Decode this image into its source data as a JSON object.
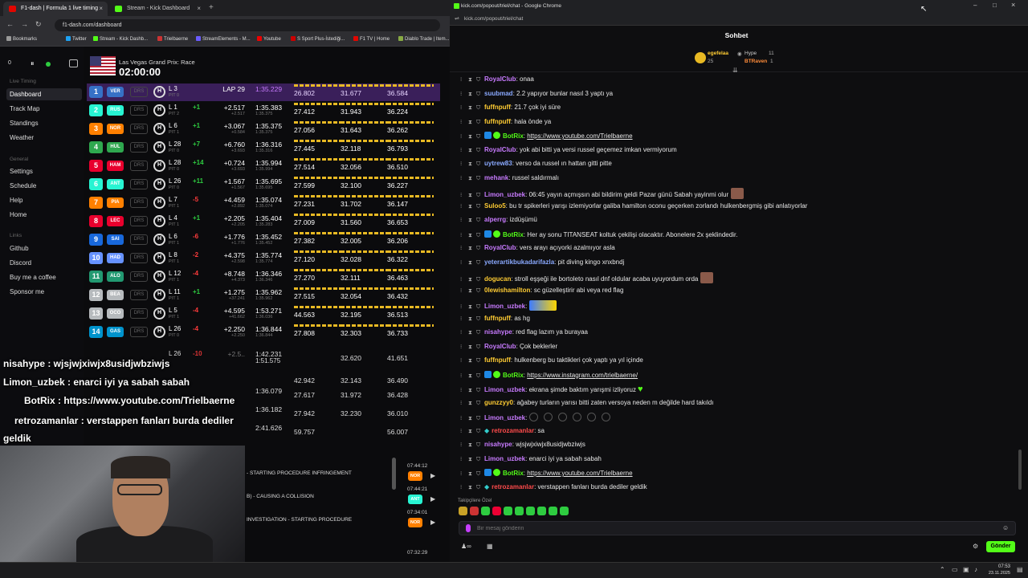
{
  "left_browser": {
    "tabs": [
      {
        "label": "F1-dash | Formula 1 live timing"
      },
      {
        "label": "Stream - Kick Dashboard"
      }
    ],
    "new_tab": "+",
    "url": "f1-dash.com/dashboard",
    "bookmarks": [
      "Bookmarks",
      "Twitter",
      "Stream - Kick Dashb...",
      "Trielbaerne",
      "StreamElements - M...",
      "Youtube",
      "S Sport Plus-İstediği...",
      "F1 TV | Home",
      "Diablo Trade | Item..."
    ]
  },
  "dashboard": {
    "race_name": "Las Vegas Grand Prix: Race",
    "clock": "02:00:00",
    "controls": {
      "count": "0",
      "pause": "⏸"
    },
    "sidebar": {
      "live_timing_header": "Live Timing",
      "live_items": [
        "Dashboard",
        "Track Map",
        "Standings",
        "Weather"
      ],
      "general_header": "General",
      "general_items": [
        "Settings",
        "Schedule",
        "Help",
        "Home"
      ],
      "links_header": "Links",
      "links_items": [
        "Github",
        "Discord",
        "Buy me a coffee",
        "Sponsor me"
      ]
    },
    "drs_label": "DRS",
    "rows": [
      {
        "pos": "1",
        "team": "VER",
        "color": "#3671C6",
        "tyre": "H",
        "lap": "L 3",
        "pit": "PIT 0",
        "pm": "",
        "gap": "LAP 29",
        "gap2": "",
        "lt": "1:35.229",
        "lt2": "",
        "s1": "26.802",
        "s2": "31.677",
        "s3": "36.584",
        "hl": true
      },
      {
        "pos": "2",
        "team": "RUS",
        "color": "#27F4D2",
        "tyre": "H",
        "lap": "L 1",
        "pit": "PIT 2",
        "pm": "+1",
        "gap": "+2.517",
        "gap2": "+2.517",
        "lt": "1:35.383",
        "lt2": "1:35.375",
        "s1": "27.412",
        "s2": "31.943",
        "s3": "36.224"
      },
      {
        "pos": "3",
        "team": "NOR",
        "color": "#FF8000",
        "tyre": "H",
        "lap": "L 6",
        "pit": "PIT 1",
        "pm": "+1",
        "gap": "+3.067",
        "gap2": "+0.584",
        "lt": "1:35.375",
        "lt2": "1:35.375",
        "s1": "27.056",
        "s2": "31.643",
        "s3": "36.262"
      },
      {
        "pos": "4",
        "team": "HUL",
        "color": "#2fa84f",
        "tyre": "H",
        "lap": "L 28",
        "pit": "PIT 0",
        "pm": "+7",
        "gap": "+6.760",
        "gap2": "+3.693",
        "lt": "1:36.316",
        "lt2": "1:35.316",
        "s1": "27.445",
        "s2": "32.118",
        "s3": "36.793"
      },
      {
        "pos": "5",
        "team": "HAM",
        "color": "#E8002D",
        "tyre": "H",
        "lap": "L 28",
        "pit": "PIT 0",
        "pm": "+14",
        "gap": "+0.724",
        "gap2": "+3.693",
        "lt": "1:35.994",
        "lt2": "1:35.994",
        "s1": "27.514",
        "s2": "32.056",
        "s3": "36.510"
      },
      {
        "pos": "6",
        "team": "ANT",
        "color": "#27F4D2",
        "tyre": "H",
        "lap": "L 26",
        "pit": "PIT 0",
        "pm": "+11",
        "gap": "+1.567",
        "gap2": "+1.567",
        "lt": "1:35.695",
        "lt2": "1:35.695",
        "s1": "27.599",
        "s2": "32.100",
        "s3": "36.227"
      },
      {
        "pos": "7",
        "team": "PIA",
        "color": "#FF8000",
        "tyre": "H",
        "lap": "L 7",
        "pit": "PIT 1",
        "pm": "-5",
        "gap": "+4.459",
        "gap2": "+2.892",
        "lt": "1:35.074",
        "lt2": "1:35.074",
        "s1": "27.231",
        "s2": "31.702",
        "s3": "36.147"
      },
      {
        "pos": "8",
        "team": "LEC",
        "color": "#E8002D",
        "tyre": "H",
        "lap": "L 4",
        "pit": "PIT 1",
        "pm": "+1",
        "gap": "+2.205",
        "gap2": "+2.205",
        "lt": "1:35.404",
        "lt2": "1:35.283",
        "s1": "27.009",
        "s2": "31.560",
        "s3": "36.653"
      },
      {
        "pos": "9",
        "team": "SAI",
        "color": "#1868DB",
        "tyre": "H",
        "lap": "L 6",
        "pit": "PIT 1",
        "pm": "-6",
        "gap": "+1.776",
        "gap2": "+1.776",
        "lt": "1:35.452",
        "lt2": "1:35.452",
        "s1": "27.382",
        "s2": "32.005",
        "s3": "36.206"
      },
      {
        "pos": "10",
        "team": "HAD",
        "color": "#6692FF",
        "tyre": "H",
        "lap": "L 8",
        "pit": "PIT 1",
        "pm": "-2",
        "gap": "+4.375",
        "gap2": "+2.598",
        "lt": "1:35.774",
        "lt2": "1:35.774",
        "s1": "27.120",
        "s2": "32.028",
        "s3": "36.322"
      },
      {
        "pos": "11",
        "team": "ALO",
        "color": "#229971",
        "tyre": "H",
        "lap": "L 12",
        "pit": "PIT 1",
        "pm": "-4",
        "gap": "+8.748",
        "gap2": "+4.373",
        "lt": "1:36.346",
        "lt2": "1:36.346",
        "s1": "27.270",
        "s2": "32.111",
        "s3": "36.463"
      },
      {
        "pos": "12",
        "team": "BEA",
        "color": "#B6BABD",
        "tyre": "H",
        "lap": "L 11",
        "pit": "PIT 1",
        "pm": "+1",
        "gap": "+1.275",
        "gap2": "+37.241",
        "lt": "1:35.962",
        "lt2": "1:35.962",
        "s1": "27.515",
        "s2": "32.054",
        "s3": "36.432"
      },
      {
        "pos": "13",
        "team": "OCO",
        "color": "#B6BABD",
        "tyre": "H",
        "lap": "L 5",
        "pit": "PIT 1",
        "pm": "-4",
        "gap": "+4.595",
        "gap2": "+41.662",
        "lt": "1:53.271",
        "lt2": "1:36.036",
        "s1": "44.563",
        "s2": "32.195",
        "s3": "36.513"
      },
      {
        "pos": "14",
        "team": "GAS",
        "color": "#0093CC",
        "tyre": "H",
        "lap": "L 26",
        "pit": "PIT 0",
        "pm": "-4",
        "gap": "+2.250",
        "gap2": "+2.250",
        "lt": "1:36.844",
        "lt2": "1:36.844",
        "s1": "27.808",
        "s2": "32.303",
        "s3": "36.733"
      }
    ],
    "hidden_rows": [
      {
        "lap": "L 26",
        "pm": "-10",
        "gap": "+2.5..",
        "lt": "1:42.231",
        "lt2": "1:51.575",
        "s1": "",
        "s2": "32.620",
        "s3": "41.651"
      },
      {
        "lap": "",
        "pm": "",
        "gap": "",
        "lt": "",
        "lt2": "",
        "s1": "42.942",
        "s2": "32.143",
        "s3": "36.490"
      },
      {
        "lap": "",
        "pm": "",
        "gap": "",
        "lt": "1:36.079",
        "lt2": "",
        "s1": "27.617",
        "s2": "31.972",
        "s3": "36.428"
      },
      {
        "lap": "",
        "pm": "",
        "gap": "",
        "lt": "1:36.182",
        "lt2": "",
        "s1": "27.942",
        "s2": "32.230",
        "s3": "36.010"
      },
      {
        "lap": "",
        "pm": "",
        "gap": "",
        "lt": "2:41.626",
        "lt2": "",
        "s1": "59.757",
        "s2": "",
        "s3": "56.007"
      }
    ],
    "overlay_chat": [
      {
        "text": "nisahype : wjsjwjxiwjx8usidjwbziwjs"
      },
      {
        "text": "Limon_uzbek : enarci iyi ya sabah sabah"
      },
      {
        "text": "BotRix : https://www.youtube.com/Trielbaerne"
      },
      {
        "text": "retrozamanlar : verstappen fanları burda dediler"
      },
      {
        "text": "geldik"
      }
    ],
    "race_control": [
      {
        "text": "- STARTING PROCEDURE INFRINGEMENT",
        "time": "07:44:12",
        "team": "NOR",
        "color": "#FF8000"
      },
      {
        "text": "B) - CAUSING A COLLISION",
        "time": "07:44:21",
        "team": "ANT",
        "color": "#27F4D2"
      },
      {
        "text": "INVESTIGATION - STARTING PROCEDURE",
        "time": "07:34:01",
        "team": "NOR",
        "color": "#FF8000"
      }
    ],
    "race_control_last_time": "07:32:29"
  },
  "chat_window": {
    "title": "kick.com/popout/triel/chat - Google Chrome",
    "url": "kick.com/popout/triel/chat",
    "header": "Sohbet",
    "pinned_user": "egefelaa",
    "pinned_count": "25",
    "hype_label": "Hype",
    "hype_count": "11",
    "hype_user": "BTRaven",
    "hype_user_count": "1",
    "messages": [
      {
        "user": "RoyalClub",
        "color": "#c87bff",
        "text": "onaa"
      },
      {
        "user": "suubmad",
        "color": "#8aa9ff",
        "text": "2.2 yapıyor bunlar nasıl 3 yaptı ya"
      },
      {
        "user": "fuffnpuff",
        "color": "#ffcc33",
        "text": "21.7 çok iyi süre"
      },
      {
        "user": "fuffnpuff",
        "color": "#ffcc33",
        "text": "hala önde ya"
      },
      {
        "user": "BotRix",
        "color": "#53fc18",
        "text": "https://www.youtube.com/Trielbaerne",
        "link": true
      },
      {
        "user": "RoyalClub",
        "color": "#c87bff",
        "text": "yok abi bitti ya versi russel geçemez imkan vermiyorum"
      },
      {
        "user": "uytrew83",
        "color": "#8aa9ff",
        "text": "verso da russel ın hattan gitti pitte"
      },
      {
        "user": "mehank",
        "color": "#c87bff",
        "text": "russel saldırmalı"
      },
      {
        "user": "Limon_uzbek",
        "color": "#c87bff",
        "text": "06:45 yayın açmışsın abi bildirim geldi Pazar günü Sabah yayinmi olur"
      },
      {
        "user": "Suloo5",
        "color": "#ffcc33",
        "text": "bu tr spikerleri yarışı izlemiyorlar galiba hamilton oconu geçerken zorlandı hulkenbergmiş gibi anlatıyorlar"
      },
      {
        "user": "alperrg",
        "color": "#c87bff",
        "text": "izdüşümü"
      },
      {
        "user": "BotRix",
        "color": "#53fc18",
        "text": "Her ay sonu TITANSEAT koltuk çekilişi olacaktır. Abonelere 2x şeklindedir."
      },
      {
        "user": "RoyalClub",
        "color": "#c87bff",
        "text": "vers arayı açıyorki azalmıyor asla"
      },
      {
        "user": "yeterartikbukadarifazla",
        "color": "#8aa9ff",
        "text": "pit diving kingo xnxbndj"
      },
      {
        "user": "dogucan",
        "color": "#ffcc33",
        "text": "stroll eşşeği ile bortoleto nasıl dnf oldular acaba uyuyordum orda"
      },
      {
        "user": "0lewishamilton",
        "color": "#ffcc33",
        "text": "sc güzelleştirir abi veya red flag"
      },
      {
        "user": "Limon_uzbek",
        "color": "#c87bff",
        "text": ""
      },
      {
        "user": "fuffnpuff",
        "color": "#ffcc33",
        "text": "as hg"
      },
      {
        "user": "nisahype",
        "color": "#c87bff",
        "text": "red flag lazım ya burayaa"
      },
      {
        "user": "RoyalClub",
        "color": "#c87bff",
        "text": "Çok beklerler"
      },
      {
        "user": "fuffnpuff",
        "color": "#ffcc33",
        "text": "hulkenberg bu taktikleri çok yaptı ya yıl içinde"
      },
      {
        "user": "BotRix",
        "color": "#53fc18",
        "text": "https://www.instagram.com/trielbaerne/",
        "link": true
      },
      {
        "user": "Limon_uzbek",
        "color": "#c87bff",
        "text": "ekrana şimde baktım yarışmi izliyoruz"
      },
      {
        "user": "gunzzyy0",
        "color": "#ffcc33",
        "text": "ağabey turların yarısı bitti zaten versoya neden m değilde hard takıldı"
      },
      {
        "user": "Limon_uzbek",
        "color": "#c87bff",
        "text": ""
      },
      {
        "user": "retrozamanlar",
        "color": "#ff4b4b",
        "text": "sa"
      },
      {
        "user": "nisahype",
        "color": "#c87bff",
        "text": "wjsjwjxiwjx8usidjwbziwjs"
      },
      {
        "user": "Limon_uzbek",
        "color": "#c87bff",
        "text": "enarci iyi ya sabah sabah"
      },
      {
        "user": "BotRix",
        "color": "#53fc18",
        "text": "https://www.youtube.com/Trielbaerne",
        "link": true
      },
      {
        "user": "retrozamanlar",
        "color": "#ff4b4b",
        "text": "verstappen fanları burda dediler geldik"
      }
    ],
    "followers_label": "Takipçilere Özel",
    "input_placeholder": "Bir mesaj gönderin",
    "send_label": "Gönder"
  },
  "taskbar": {
    "time": "07:53",
    "date": "23.11.2025"
  }
}
